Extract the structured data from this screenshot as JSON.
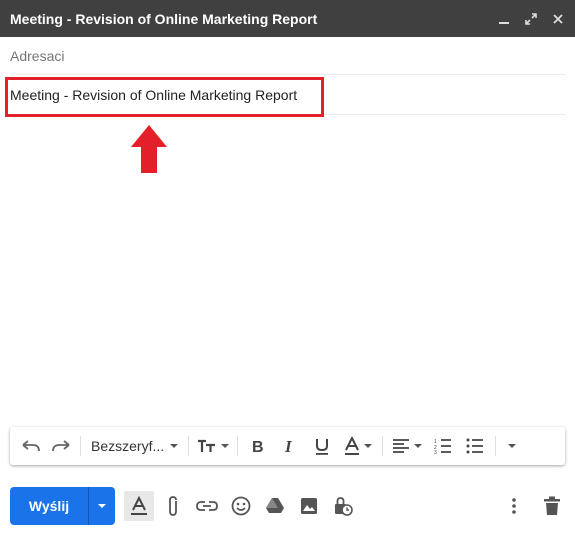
{
  "window": {
    "title": "Meeting - Revision of Online Marketing Report",
    "controls": [
      "minimize-icon",
      "expand-icon",
      "close-icon"
    ]
  },
  "compose": {
    "recipients_placeholder": "Adresaci",
    "subject": "Meeting - Revision of Online Marketing Report"
  },
  "annotation": {
    "highlight_color": "#e3202a",
    "arrow_icon": "arrow-up-icon"
  },
  "formatting_toolbar": {
    "font_name": "Bezszeryf...",
    "icons": [
      "undo-icon",
      "redo-icon",
      "font-size-icon",
      "bold-icon",
      "italic-icon",
      "underline-icon",
      "text-color-icon",
      "align-icon",
      "numbered-list-icon",
      "bulleted-list-icon",
      "more-formatting-icon"
    ]
  },
  "bottom_bar": {
    "send_label": "Wyślij",
    "send_color": "#1a73e8",
    "icons": [
      "formatting-options-icon",
      "attach-icon",
      "link-icon",
      "emoji-icon",
      "drive-icon",
      "photo-icon",
      "confidential-mode-icon",
      "more-options-icon",
      "discard-icon"
    ]
  }
}
